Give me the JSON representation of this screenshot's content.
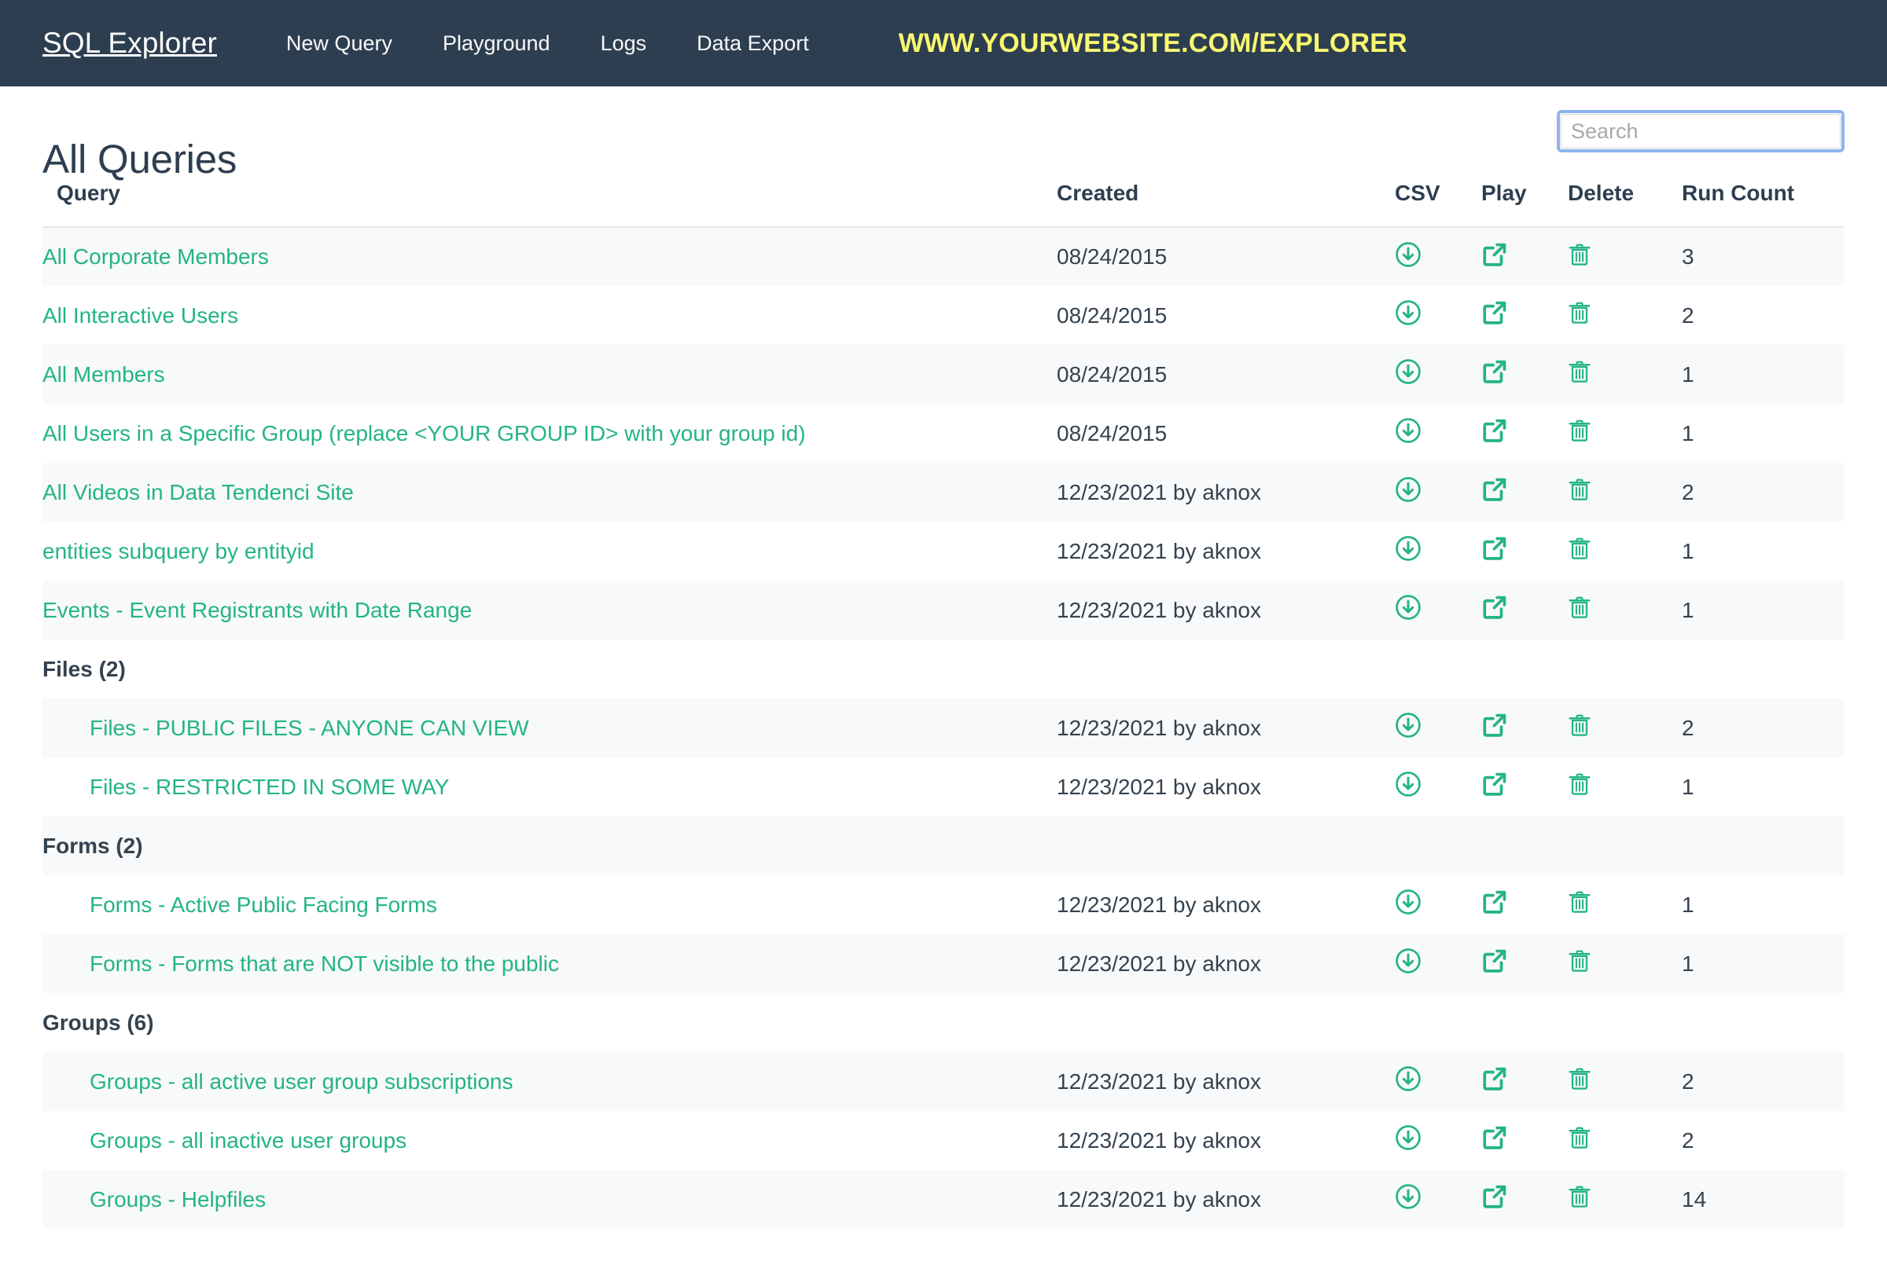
{
  "navbar": {
    "brand": "SQL Explorer",
    "links": [
      {
        "label": "New Query",
        "name": "nav-new-query"
      },
      {
        "label": "Playground",
        "name": "nav-playground"
      },
      {
        "label": "Logs",
        "name": "nav-logs"
      },
      {
        "label": "Data Export",
        "name": "nav-data-export"
      }
    ],
    "site_url": "WWW.YOURWEBSITE.COM/EXPLORER",
    "bg_color": "#2d3e50",
    "url_color": "#f9f871"
  },
  "page": {
    "title": "All Queries"
  },
  "search": {
    "value": "",
    "placeholder": "Search",
    "focus_ring_color": "#8cb4f0"
  },
  "table": {
    "columns": {
      "query": "Query",
      "created": "Created",
      "csv": "CSV",
      "play": "Play",
      "delete": "Delete",
      "run_count": "Run Count"
    },
    "icons": {
      "csv": "download-circle-icon",
      "play": "external-link-icon",
      "delete": "trash-icon"
    },
    "link_color": "#23b486",
    "rows": [
      {
        "type": "query",
        "indent": false,
        "title": "All Corporate Members",
        "created": "08/24/2015",
        "run_count": "3"
      },
      {
        "type": "query",
        "indent": false,
        "title": "All Interactive Users",
        "created": "08/24/2015",
        "run_count": "2"
      },
      {
        "type": "query",
        "indent": false,
        "title": "All Members",
        "created": "08/24/2015",
        "run_count": "1"
      },
      {
        "type": "query",
        "indent": false,
        "title": "All Users in a Specific Group (replace <YOUR GROUP ID> with your group id)",
        "created": "08/24/2015",
        "run_count": "1"
      },
      {
        "type": "query",
        "indent": false,
        "title": "All Videos in Data Tendenci Site",
        "created": "12/23/2021 by aknox",
        "run_count": "2"
      },
      {
        "type": "query",
        "indent": false,
        "title": "entities subquery by entityid",
        "created": "12/23/2021 by aknox",
        "run_count": "1"
      },
      {
        "type": "query",
        "indent": false,
        "title": "Events - Event Registrants with Date Range",
        "created": "12/23/2021 by aknox",
        "run_count": "1"
      },
      {
        "type": "group",
        "label": "Files (2)"
      },
      {
        "type": "query",
        "indent": true,
        "title": "Files - PUBLIC FILES - ANYONE CAN VIEW",
        "created": "12/23/2021 by aknox",
        "run_count": "2"
      },
      {
        "type": "query",
        "indent": true,
        "title": "Files - RESTRICTED IN SOME WAY",
        "created": "12/23/2021 by aknox",
        "run_count": "1"
      },
      {
        "type": "group",
        "label": "Forms (2)"
      },
      {
        "type": "query",
        "indent": true,
        "title": "Forms - Active Public Facing Forms",
        "created": "12/23/2021 by aknox",
        "run_count": "1"
      },
      {
        "type": "query",
        "indent": true,
        "title": "Forms - Forms that are NOT visible to the public",
        "created": "12/23/2021 by aknox",
        "run_count": "1"
      },
      {
        "type": "group",
        "label": "Groups (6)"
      },
      {
        "type": "query",
        "indent": true,
        "title": "Groups - all active user group subscriptions",
        "created": "12/23/2021 by aknox",
        "run_count": "2"
      },
      {
        "type": "query",
        "indent": true,
        "title": "Groups - all inactive user groups",
        "created": "12/23/2021 by aknox",
        "run_count": "2"
      },
      {
        "type": "query",
        "indent": true,
        "title": "Groups - Helpfiles",
        "created": "12/23/2021 by aknox",
        "run_count": "14"
      }
    ]
  }
}
